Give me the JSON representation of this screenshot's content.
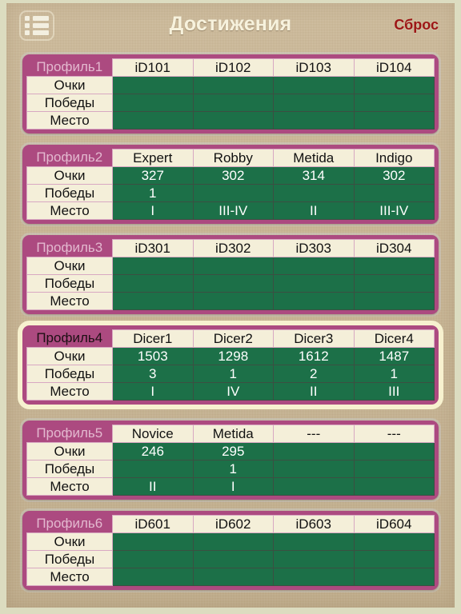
{
  "header": {
    "title": "Достижения",
    "reset_label": "Сброс",
    "menu_icon": "list-menu-icon"
  },
  "colors": {
    "card": "#ac4a80",
    "cell_green": "#1c7048",
    "label_cream": "#f4efd9",
    "reset_red": "#9d1616",
    "selected_border": "#f7f1cf",
    "background": "#c9b694"
  },
  "row_labels": [
    "Очки",
    "Победы",
    "Место"
  ],
  "profiles": [
    {
      "name": "Профиль1",
      "selected": false,
      "columns": [
        "iD101",
        "iD102",
        "iD103",
        "iD104"
      ],
      "rows": [
        [
          "",
          "",
          "",
          ""
        ],
        [
          "",
          "",
          "",
          ""
        ],
        [
          "",
          "",
          "",
          ""
        ]
      ]
    },
    {
      "name": "Профиль2",
      "selected": false,
      "columns": [
        "Expert",
        "Robby",
        "Metida",
        "Indigo"
      ],
      "rows": [
        [
          "327",
          "302",
          "314",
          "302"
        ],
        [
          "1",
          "",
          "",
          ""
        ],
        [
          "I",
          "III-IV",
          "II",
          "III-IV"
        ]
      ]
    },
    {
      "name": "Профиль3",
      "selected": false,
      "columns": [
        "iD301",
        "iD302",
        "iD303",
        "iD304"
      ],
      "rows": [
        [
          "",
          "",
          "",
          ""
        ],
        [
          "",
          "",
          "",
          ""
        ],
        [
          "",
          "",
          "",
          ""
        ]
      ]
    },
    {
      "name": "Профиль4",
      "selected": true,
      "columns": [
        "Dicer1",
        "Dicer2",
        "Dicer3",
        "Dicer4"
      ],
      "rows": [
        [
          "1503",
          "1298",
          "1612",
          "1487"
        ],
        [
          "3",
          "1",
          "2",
          "1"
        ],
        [
          "I",
          "IV",
          "II",
          "III"
        ]
      ]
    },
    {
      "name": "Профиль5",
      "selected": false,
      "columns": [
        "Novice",
        "Metida",
        "---",
        "---"
      ],
      "rows": [
        [
          "246",
          "295",
          "",
          ""
        ],
        [
          "",
          "1",
          "",
          ""
        ],
        [
          "II",
          "I",
          "",
          ""
        ]
      ]
    },
    {
      "name": "Профиль6",
      "selected": false,
      "columns": [
        "iD601",
        "iD602",
        "iD603",
        "iD604"
      ],
      "rows": [
        [
          "",
          "",
          "",
          ""
        ],
        [
          "",
          "",
          "",
          ""
        ],
        [
          "",
          "",
          "",
          ""
        ]
      ]
    }
  ]
}
